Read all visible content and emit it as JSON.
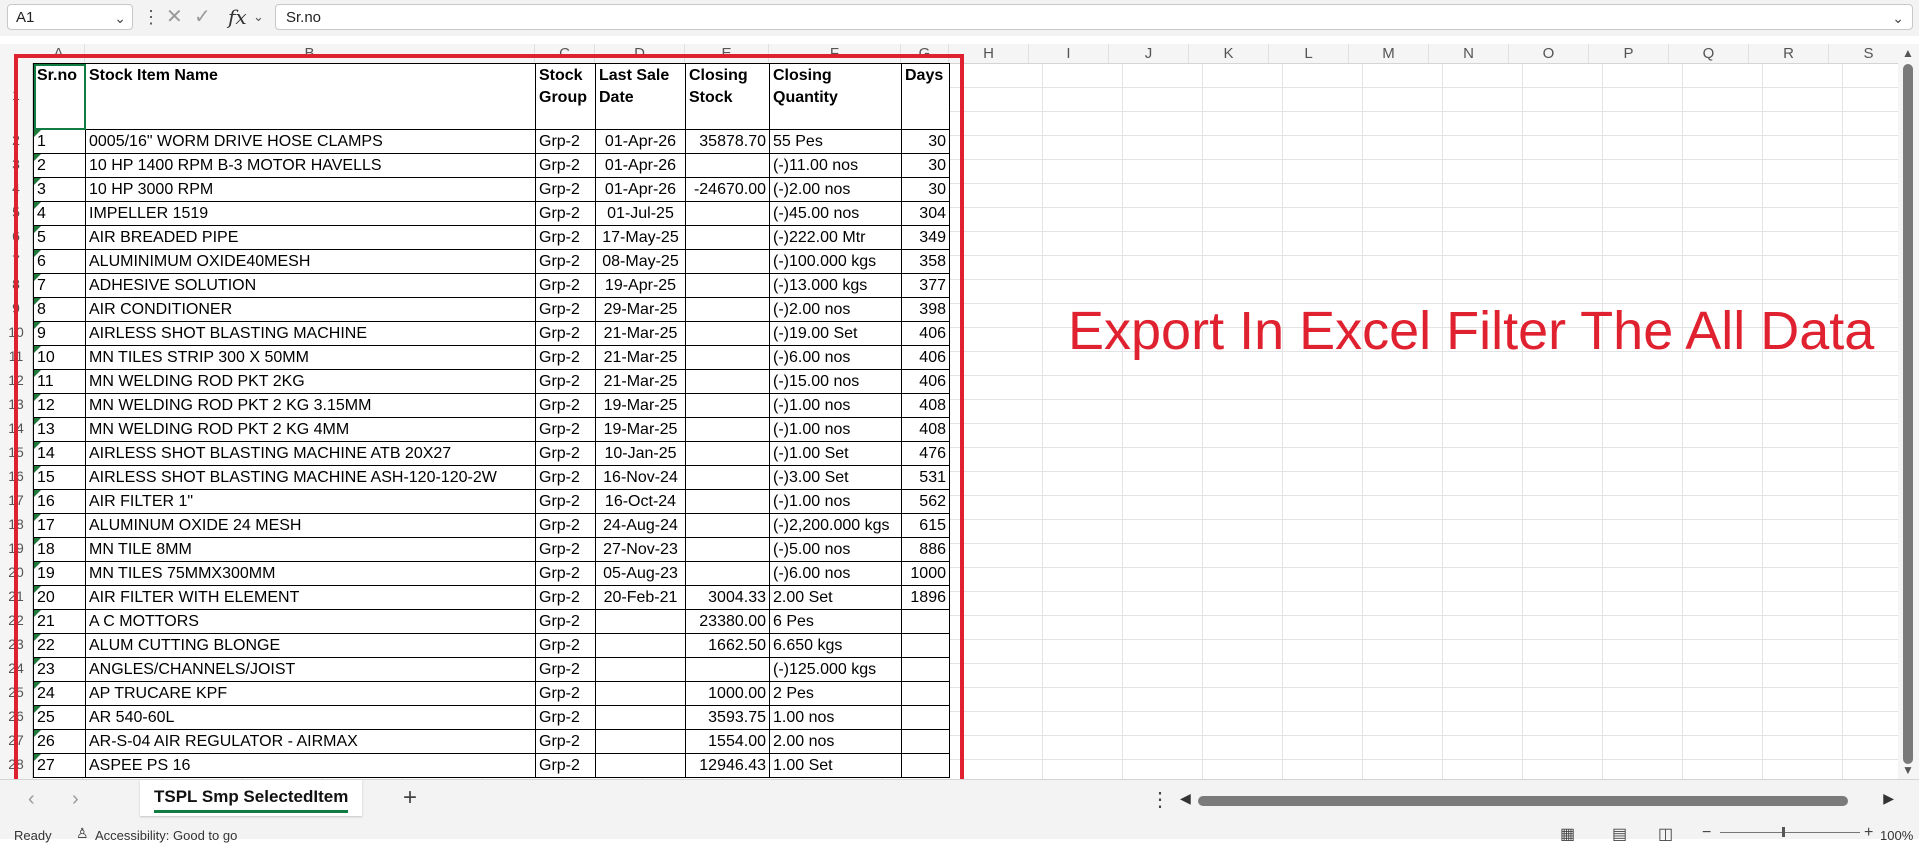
{
  "formula_bar": {
    "name_box": "A1",
    "formula": "Sr.no",
    "fx_label": "fx"
  },
  "columns": [
    "A",
    "B",
    "C",
    "D",
    "E",
    "F",
    "G",
    "H",
    "I",
    "J",
    "K",
    "L",
    "M",
    "N",
    "O",
    "P",
    "Q",
    "R",
    "S"
  ],
  "row_numbers": [
    "1",
    "2",
    "3",
    "4",
    "5",
    "6",
    "7",
    "8",
    "9",
    "10",
    "11",
    "12",
    "13",
    "14",
    "15",
    "16",
    "17",
    "18",
    "19",
    "20",
    "21",
    "22",
    "23",
    "24",
    "25",
    "26",
    "27",
    "28"
  ],
  "table": {
    "headers": [
      "Sr.no",
      "Stock Item Name",
      "Stock Group",
      "Last Sale Date",
      "Closing Stock",
      "Closing Quantity",
      "Days"
    ],
    "rows": [
      [
        "1",
        "0005/16\" WORM DRIVE HOSE CLAMPS",
        "Grp-2",
        "01-Apr-26",
        "35878.70",
        "55 Pes",
        "30"
      ],
      [
        "2",
        "10 HP 1400 RPM B-3 MOTOR HAVELLS",
        "Grp-2",
        "01-Apr-26",
        "",
        "(-)11.00 nos",
        "30"
      ],
      [
        "3",
        "10 HP 3000 RPM",
        "Grp-2",
        "01-Apr-26",
        "-24670.00",
        "(-)2.00 nos",
        "30"
      ],
      [
        "4",
        "IMPELLER 1519",
        "Grp-2",
        "01-Jul-25",
        "",
        "(-)45.00 nos",
        "304"
      ],
      [
        "5",
        "AIR BREADED PIPE",
        "Grp-2",
        "17-May-25",
        "",
        "(-)222.00 Mtr",
        "349"
      ],
      [
        "6",
        "ALUMINIMUM OXIDE40MESH",
        "Grp-2",
        "08-May-25",
        "",
        "(-)100.000 kgs",
        "358"
      ],
      [
        "7",
        "ADHESIVE SOLUTION",
        "Grp-2",
        "19-Apr-25",
        "",
        "(-)13.000 kgs",
        "377"
      ],
      [
        "8",
        "AIR CONDITIONER",
        "Grp-2",
        "29-Mar-25",
        "",
        "(-)2.00 nos",
        "398"
      ],
      [
        "9",
        "AIRLESS SHOT BLASTING MACHINE",
        "Grp-2",
        "21-Mar-25",
        "",
        "(-)19.00 Set",
        "406"
      ],
      [
        "10",
        "MN TILES STRIP 300 X 50MM",
        "Grp-2",
        "21-Mar-25",
        "",
        "(-)6.00 nos",
        "406"
      ],
      [
        "11",
        "MN WELDING ROD PKT 2KG",
        "Grp-2",
        "21-Mar-25",
        "",
        "(-)15.00 nos",
        "406"
      ],
      [
        "12",
        "MN WELDING ROD PKT 2 KG 3.15MM",
        "Grp-2",
        "19-Mar-25",
        "",
        "(-)1.00 nos",
        "408"
      ],
      [
        "13",
        "MN WELDING ROD PKT 2 KG 4MM",
        "Grp-2",
        "19-Mar-25",
        "",
        "(-)1.00 nos",
        "408"
      ],
      [
        "14",
        "AIRLESS SHOT BLASTING MACHINE ATB 20X27",
        "Grp-2",
        "10-Jan-25",
        "",
        "(-)1.00 Set",
        "476"
      ],
      [
        "15",
        "AIRLESS SHOT BLASTING MACHINE ASH-120-120-2W",
        "Grp-2",
        "16-Nov-24",
        "",
        "(-)3.00 Set",
        "531"
      ],
      [
        "16",
        "AIR FILTER 1\"",
        "Grp-2",
        "16-Oct-24",
        "",
        "(-)1.00 nos",
        "562"
      ],
      [
        "17",
        "ALUMINUM OXIDE 24 MESH",
        "Grp-2",
        "24-Aug-24",
        "",
        "(-)2,200.000 kgs",
        "615"
      ],
      [
        "18",
        "MN TILE 8MM",
        "Grp-2",
        "27-Nov-23",
        "",
        "(-)5.00 nos",
        "886"
      ],
      [
        "19",
        "MN TILES 75MMX300MM",
        "Grp-2",
        "05-Aug-23",
        "",
        "(-)6.00 nos",
        "1000"
      ],
      [
        "20",
        "AIR FILTER WITH ELEMENT",
        "Grp-2",
        "20-Feb-21",
        "3004.33",
        "2.00 Set",
        "1896"
      ],
      [
        "21",
        "A C MOTTORS",
        "Grp-2",
        "",
        "23380.00",
        "6 Pes",
        ""
      ],
      [
        "22",
        "ALUM CUTTING BLONGE",
        "Grp-2",
        "",
        "1662.50",
        "6.650 kgs",
        ""
      ],
      [
        "23",
        "ANGLES/CHANNELS/JOIST",
        "Grp-2",
        "",
        "",
        "(-)125.000 kgs",
        ""
      ],
      [
        "24",
        "AP TRUCARE KPF",
        "Grp-2",
        "",
        "1000.00",
        "2 Pes",
        ""
      ],
      [
        "25",
        "AR 540-60L",
        "Grp-2",
        "",
        "3593.75",
        "1.00 nos",
        ""
      ],
      [
        "26",
        "AR-S-04 AIR REGULATOR - AIRMAX",
        "Grp-2",
        "",
        "1554.00",
        "2.00 nos",
        ""
      ],
      [
        "27",
        "ASPEE PS 16",
        "Grp-2",
        "",
        "12946.43",
        "1.00 Set",
        ""
      ]
    ]
  },
  "annotation": "Export In Excel Filter The All Data",
  "sheet_tab": "TSPL Smp SelectedItem",
  "status": {
    "ready": "Ready",
    "accessibility": "Accessibility: Good to go",
    "zoom": "100%"
  },
  "colors": {
    "annotation_red": "#e0212f",
    "excel_green": "#107c41"
  },
  "icons": {
    "name_box_dropdown": "chevron-down-icon",
    "cancel": "close-icon",
    "enter": "check-icon",
    "function": "fx-icon",
    "add_sheet": "plus-icon",
    "accessibility": "accessibility-icon"
  }
}
